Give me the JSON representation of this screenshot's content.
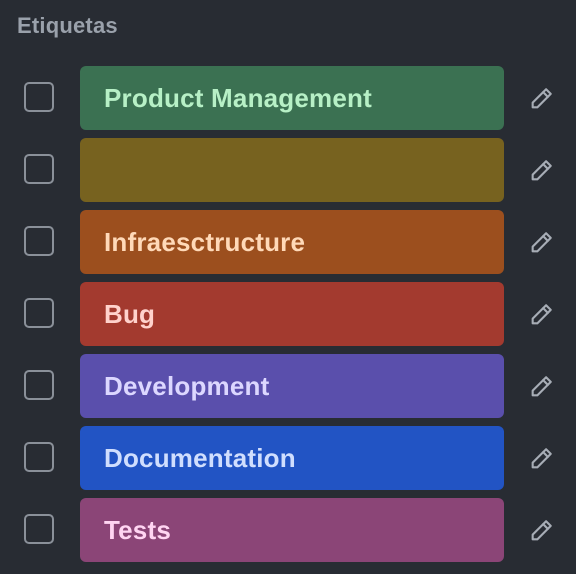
{
  "header": {
    "title": "Etiquetas"
  },
  "labels": [
    {
      "name": "Product Management",
      "bg": "#3b7152",
      "fg": "#b7f0c6"
    },
    {
      "name": "",
      "bg": "#77621f",
      "fg": "#f0dc9a"
    },
    {
      "name": "Infraesctructure",
      "bg": "#9c4f1e",
      "fg": "#ffd9b8"
    },
    {
      "name": "Bug",
      "bg": "#a33a2f",
      "fg": "#ffd2cc"
    },
    {
      "name": "Development",
      "bg": "#5a4fac",
      "fg": "#dcd7ff"
    },
    {
      "name": "Documentation",
      "bg": "#2254c4",
      "fg": "#d0defe"
    },
    {
      "name": "Tests",
      "bg": "#8b4577",
      "fg": "#ffd5f2"
    }
  ],
  "icons": {
    "edit": "pencil-icon"
  }
}
